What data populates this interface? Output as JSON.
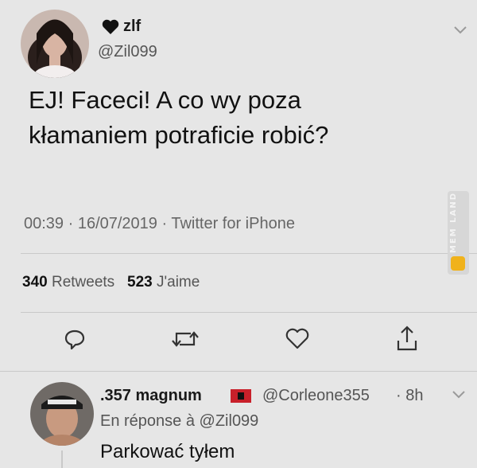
{
  "tweet": {
    "author_name": "zlf",
    "author_handle": "@Zil099",
    "text_line1": "EJ! Faceci! A co wy poza",
    "text_line2": "kłamaniem potraficie robić?",
    "timestamp": "00:39 · 16/07/2019 · Twitter for iPhone",
    "retweets_count": "340",
    "retweets_label": "Retweets",
    "likes_count": "523",
    "likes_label": "J'aime"
  },
  "reply": {
    "author_name": ".357 magnum",
    "author_handle": "@Corleone355",
    "time": "· 8h",
    "in_reply_to": "En réponse à @Zil099",
    "text": "Parkować tyłem"
  },
  "watermark": {
    "text": "MEM LAND"
  },
  "icons": {
    "heart_emoji": "black-heart-icon",
    "reply": "reply-icon",
    "retweet": "retweet-icon",
    "like": "like-icon",
    "share": "share-icon",
    "chevron": "chevron-down-icon",
    "flag": "flag-icon"
  }
}
